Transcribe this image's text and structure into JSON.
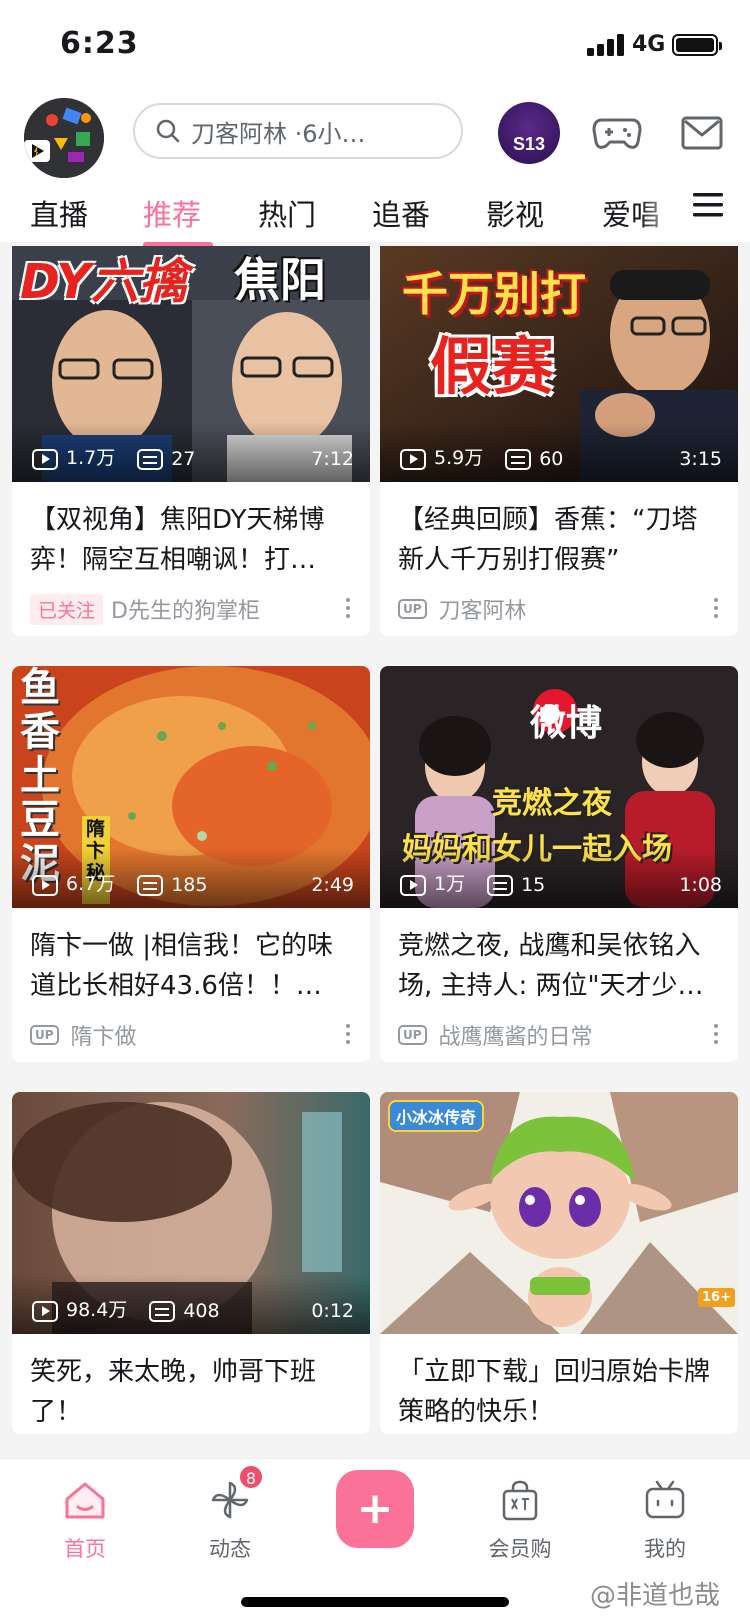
{
  "status_bar": {
    "time": "6:23",
    "network": "4G"
  },
  "header": {
    "search_placeholder": "刀客阿林 ·6小…",
    "event_badge": "S13"
  },
  "tabs": [
    {
      "label": "直播"
    },
    {
      "label": "推荐"
    },
    {
      "label": "热门"
    },
    {
      "label": "追番"
    },
    {
      "label": "影视"
    },
    {
      "label": "爱唱"
    }
  ],
  "feed": {
    "cards": [
      {
        "cover_text": [
          "DY六擒",
          "焦阳"
        ],
        "views": "1.7万",
        "danmaku": "27",
        "duration": "7:12",
        "title": "【双视角】焦阳DY天梯博弈！隔空互相嘲讽！打…",
        "followed_label": "已关注",
        "author": "D先生的狗掌柜"
      },
      {
        "cover_text": [
          "千万别打",
          "假赛"
        ],
        "views": "5.9万",
        "danmaku": "60",
        "duration": "3:15",
        "title": "【经典回顾】香蕉：“刀塔新人千万别打假赛”",
        "author_badge": "UP",
        "author": "刀客阿林"
      },
      {
        "cover_text": [
          "鱼",
          "香",
          "土",
          "豆",
          "泥",
          "隋卞秘"
        ],
        "views": "6.7万",
        "danmaku": "185",
        "duration": "2:49",
        "title": "隋卞一做 |相信我！它的味道比长相好43.6倍！！…",
        "author_badge": "UP",
        "author": "隋卞做"
      },
      {
        "cover_text": [
          "微博",
          "竞燃之夜",
          "妈妈和女儿一起入场"
        ],
        "views": "1万",
        "danmaku": "15",
        "duration": "1:08",
        "title": "竞燃之夜, 战鹰和吴依铭入场, 主持人: 两位\"天才少…",
        "author_badge": "UP",
        "author": "战鹰鹰酱的日常"
      },
      {
        "views": "98.4万",
        "danmaku": "408",
        "duration": "0:12",
        "title": "笑死，来太晚，帅哥下班了！"
      },
      {
        "cover_text": [
          "小冰冰传奇",
          "16+"
        ],
        "title": "「立即下载」回归原始卡牌策略的快乐！"
      }
    ]
  },
  "tabbar": {
    "items": [
      {
        "label": "首页"
      },
      {
        "label": "动态"
      },
      {
        "label": "会员购"
      },
      {
        "label": "我的"
      }
    ],
    "dynamic_badge": "8"
  },
  "watermark": "@非道也哉",
  "colors": {
    "accent": "#fb7299",
    "badge_red": "#f04c6b"
  }
}
